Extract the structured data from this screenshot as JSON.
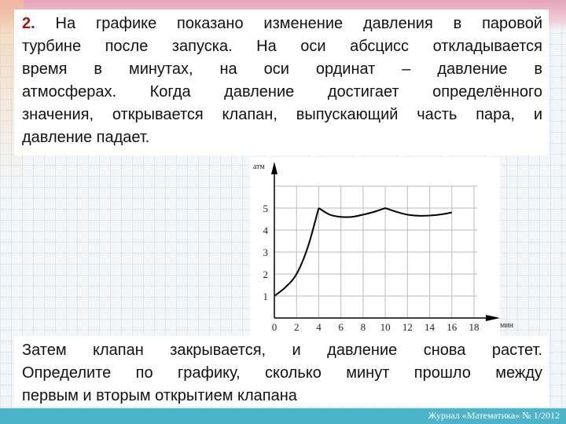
{
  "problem": {
    "number": "2.",
    "intro_lines": [
      " На графике показано изменение давления в паровой",
      "турбине после запуска. На оси абсцисс откладывается",
      "время в минутах, на оси ординат – давление в",
      "атмосферах. Когда давление достигает определённого",
      "значения, открывается клапан, выпускающий часть пара, и",
      "давление падает."
    ],
    "question_lines": [
      "Затем клапан закрывается, и давление снова растет.",
      "Определите по графику, сколько минут прошло между",
      "первым и вторым открытием клапана"
    ]
  },
  "footer": {
    "source": "Журнал «Математика» № 1/2012",
    "color": "#4cb3c9"
  },
  "chart_data": {
    "type": "line",
    "xlabel": "мин",
    "ylabel": "атм",
    "xlim": [
      0,
      18
    ],
    "ylim": [
      0,
      6
    ],
    "x_ticks": [
      "0",
      "2",
      "4",
      "6",
      "8",
      "10",
      "12",
      "14",
      "16",
      "18"
    ],
    "y_ticks": [
      "1",
      "2",
      "3",
      "4",
      "5"
    ],
    "grid": true,
    "x": [
      0,
      1,
      2,
      3,
      4,
      5,
      6,
      7,
      8,
      9,
      10,
      11,
      12,
      13,
      14,
      15,
      16
    ],
    "values": [
      1,
      1.4,
      2,
      3.2,
      5,
      4.7,
      4.6,
      4.6,
      4.7,
      4.83,
      5,
      4.83,
      4.7,
      4.65,
      4.66,
      4.71,
      4.8
    ]
  }
}
